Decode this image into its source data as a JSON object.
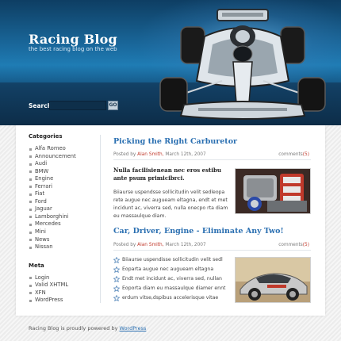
{
  "header": {
    "title": "Racing Blog",
    "tagline": "the best racing blog on the web",
    "search_label": "Search:",
    "search_value": "",
    "search_button": "GO"
  },
  "sidebar": {
    "categories_heading": "Categories",
    "categories": [
      "Alfa Romeo",
      "Announcement",
      "Audi",
      "BMW",
      "Engine",
      "Ferrari",
      "Fiat",
      "Ford",
      "Jaguar",
      "Lamborghini",
      "Mercedes",
      "Mini",
      "News",
      "Nissan"
    ],
    "meta_heading": "Meta",
    "meta": [
      "Login",
      "Valid XHTML",
      "XFN",
      "WordPress"
    ]
  },
  "posts": [
    {
      "title": "Picking the Right Carburetor",
      "posted_by": "Posted by",
      "author": "Alan Smith,",
      "date": "March 12th, 2007",
      "comments_label": "comments",
      "comments_count": "(5)",
      "intro": "Nulla facilisienean nec eros estibu ante psum primicibrci.",
      "body": "Biiaurse uspendsse sollicitudin velit sedleopa rete augue nec augueam eltagna, endt et met incidunt ac, viverra sed, nulla onecpo rta diam eu massaulque diam."
    },
    {
      "title": "Car, Driver, Engine - Eliminate Any Two!",
      "posted_by": "Posted by",
      "author": "Alan Smith,",
      "date": "March 12th, 2007",
      "comments_label": "comments",
      "comments_count": "(5)",
      "bullets": [
        "Biiaurse uspendisse sollicitudin velit sedl",
        "Eoparta augue nec augueam eltagna",
        "Endt met incidunt ac, viverra sed, nullan",
        "Eoporta diam eu massaulque diamer ennt",
        "erdum vitse,dspibus accelerisque vitae"
      ]
    }
  ],
  "footer": {
    "text": "Racing Blog is proudly powered by",
    "link": "WordPress"
  }
}
